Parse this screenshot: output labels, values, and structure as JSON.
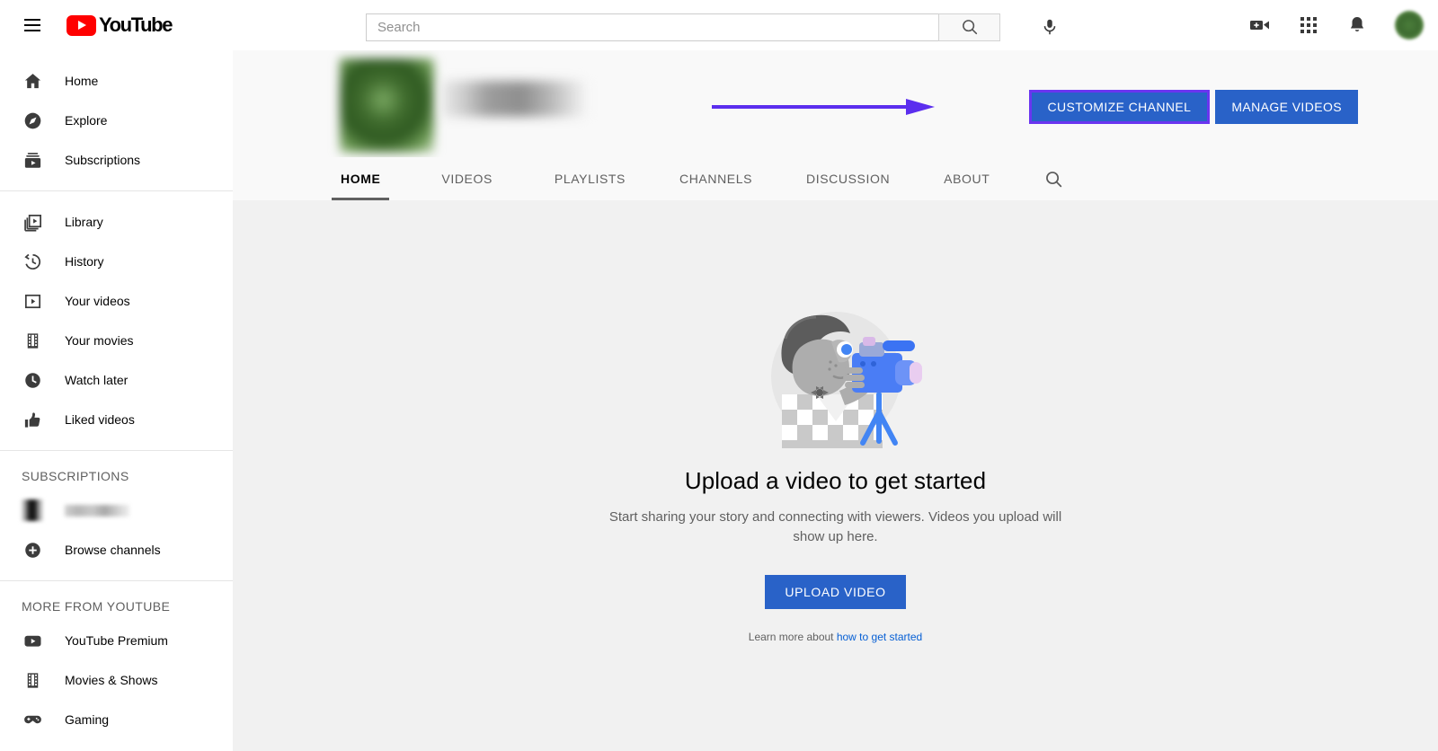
{
  "brand": {
    "logo_text": "YouTube",
    "logo_color": "#FF0000"
  },
  "topbar": {
    "menu_icon": "hamburger-icon",
    "search_placeholder": "Search",
    "search_value": "",
    "search_button_icon": "search-icon",
    "mic_icon": "microphone-icon",
    "create_icon": "video-camera-plus-icon",
    "apps_icon": "apps-grid-icon",
    "notifications_icon": "bell-icon",
    "avatar_icon": "user-avatar"
  },
  "sidebar": {
    "primary": [
      {
        "label": "Home",
        "icon": "home-icon"
      },
      {
        "label": "Explore",
        "icon": "compass-icon"
      },
      {
        "label": "Subscriptions",
        "icon": "subscriptions-icon"
      }
    ],
    "library": [
      {
        "label": "Library",
        "icon": "library-icon"
      },
      {
        "label": "History",
        "icon": "history-icon"
      },
      {
        "label": "Your videos",
        "icon": "your-videos-icon"
      },
      {
        "label": "Your movies",
        "icon": "film-strip-icon"
      },
      {
        "label": "Watch later",
        "icon": "clock-icon"
      },
      {
        "label": "Liked videos",
        "icon": "thumbs-up-icon"
      }
    ],
    "subscriptions_header": "SUBSCRIPTIONS",
    "subscriptions": [
      {
        "label": "",
        "icon": "channel-avatar-blurred",
        "redacted": true
      }
    ],
    "browse_channels": {
      "label": "Browse channels",
      "icon": "plus-circle-icon"
    },
    "more_header": "MORE FROM YOUTUBE",
    "more": [
      {
        "label": "YouTube Premium",
        "icon": "youtube-premium-icon"
      },
      {
        "label": "Movies & Shows",
        "icon": "film-strip-icon"
      },
      {
        "label": "Gaming",
        "icon": "gamepad-icon"
      }
    ]
  },
  "channel": {
    "avatar_icon": "channel-avatar-blurred",
    "name": "",
    "buttons": {
      "customize": "CUSTOMIZE CHANNEL",
      "manage": "MANAGE VIDEOS"
    },
    "tabs": [
      {
        "label": "HOME",
        "active": true
      },
      {
        "label": "VIDEOS",
        "active": false
      },
      {
        "label": "PLAYLISTS",
        "active": false
      },
      {
        "label": "CHANNELS",
        "active": false
      },
      {
        "label": "DISCUSSION",
        "active": false
      },
      {
        "label": "ABOUT",
        "active": false
      }
    ],
    "tab_search_icon": "search-icon"
  },
  "annotation": {
    "arrow_icon": "pointer-arrow",
    "arrow_color": "#5B2EEE",
    "highlight_color": "#6A35F0",
    "target": "CUSTOMIZE CHANNEL"
  },
  "empty_state": {
    "illustration_icon": "person-with-camera-illustration",
    "title": "Upload a video to get started",
    "subtitle": "Start sharing your story and connecting with viewers. Videos you upload will show up here.",
    "upload_button": "UPLOAD VIDEO",
    "learn_prefix": "Learn more about ",
    "learn_link": "how to get started"
  },
  "colors": {
    "accent_blue": "#2962C8",
    "link_blue": "#065fd4",
    "page_bg": "#f1f1f1",
    "header_bg": "#f9f9f9"
  }
}
